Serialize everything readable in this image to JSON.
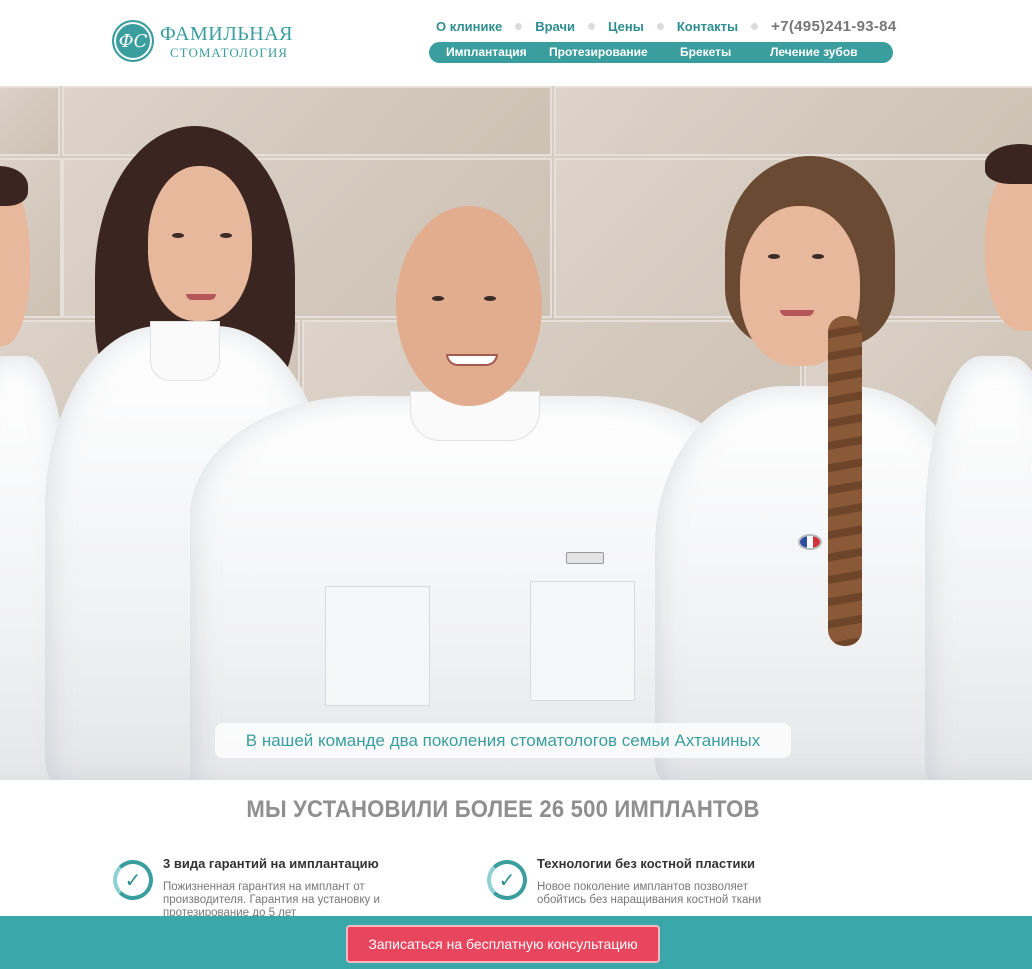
{
  "brand": {
    "monogram": "ФС",
    "name_line1": "ФАМИЛЬНАЯ",
    "name_line2": "СТОМАТОЛОГИЯ",
    "accent_color": "#3a9d9e",
    "cta_color": "#e8465f"
  },
  "top_nav": {
    "items": [
      "О клинике",
      "Врачи",
      "Цены",
      "Контакты"
    ],
    "phone": "+7(495)241-93-84"
  },
  "sub_nav": {
    "items": [
      "Имплантация",
      "Протезирование",
      "Брекеты",
      "Лечение зубов"
    ]
  },
  "hero": {
    "caption": "В нашей команде два поколения стоматологов семьи Ахтаниных"
  },
  "main": {
    "headline": "МЫ УСТАНОВИЛИ БОЛЕЕ 26 500 ИМПЛАНТОВ",
    "features": [
      {
        "icon": "check-circle-icon",
        "title": "3 вида гарантий на имплантацию",
        "text": "Пожизненная гарантия на имплант от производителя. Гарантия на установку и протезирование до 5 лет"
      },
      {
        "icon": "check-circle-icon",
        "title": "Технологии без костной пластики",
        "text": "Новое поколение имплантов позволяет обойтись без наращивания костной ткани"
      }
    ]
  },
  "cta": {
    "label": "Записаться на бесплатную консультацию"
  }
}
